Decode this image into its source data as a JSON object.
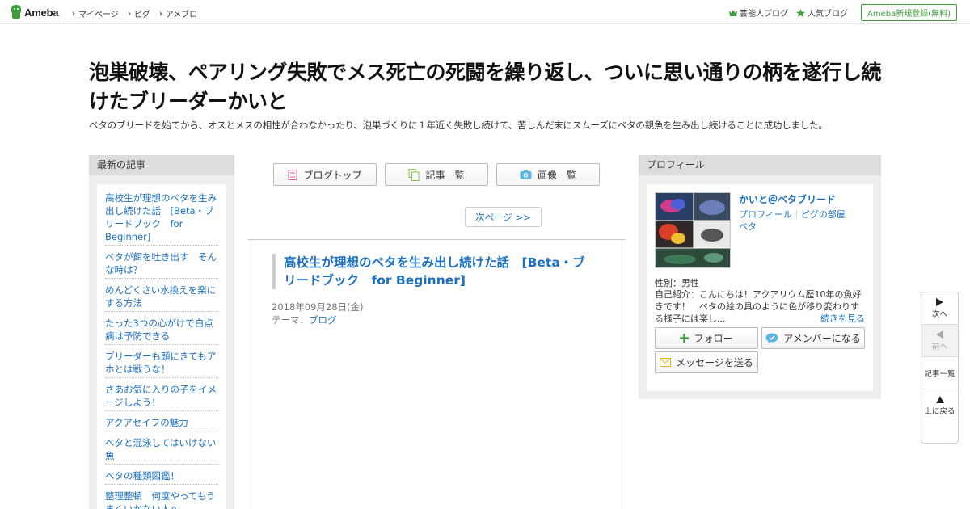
{
  "topbar": {
    "logo_text": "Ameba",
    "nav": [
      "マイページ",
      "ピグ",
      "アメブロ"
    ],
    "right": {
      "celebrity_blog": "芸能人ブログ",
      "popular_blog": "人気ブログ",
      "register": "Ameba新規登録(無料)"
    }
  },
  "header": {
    "title": "泡巣破壊、ペアリング失敗でメス死亡の死闘を繰り返し、ついに思い通りの柄を遂行し続けたブリーダーかいと",
    "description": "ベタのブリードを始てから、オスとメスの相性が合わなかったり、泡巣づくりに１年近く失敗し続けて、苦しんだ末にスムーズにベタの親魚を生み出し続けることに成功しました。"
  },
  "sidebar": {
    "heading": "最新の記事",
    "articles": [
      "高校生が理想のベタを生み出し続けた話　[Beta・ブリードブック　for Beginner]",
      "ベタが餌を吐き出す　そんな時は？",
      "めんどくさい水換えを楽にする方法",
      "たった3つの心がけで白点病は予防できる",
      "ブリーダーも頭にきてもアホとは戦うな！",
      "さあお気に入りの子をイメージしよう！",
      "アクアセイフの魅力",
      "ベタと混泳してはいけない魚",
      "ベタの種類図鑑！",
      "整理整頓　何度やってもうまくいかない人へ"
    ]
  },
  "center": {
    "buttons": {
      "blog_top": "ブログトップ",
      "article_list": "記事一覧",
      "image_list": "画像一覧"
    },
    "next_page": "次ページ >>",
    "entry": {
      "title": "高校生が理想のベタを生み出し続けた話　[Beta・ブリードブック　for Beginner]",
      "date": "2018年09月28日(金)",
      "theme_label": "テーマ：",
      "theme": "ブログ"
    }
  },
  "profile": {
    "heading": "プロフィール",
    "name": "かいと＠ベタブリード",
    "link_profile": "プロフィール",
    "link_room": "ピグの部屋",
    "link_beta": "ベタ",
    "gender": "性別：男性",
    "intro": "自己紹介：こんにちは！アクアリウム歴10年の魚好きです！　ベタの絵の具のように色が移り変わりする様子には楽し...",
    "more": "続きを見る",
    "follow": "フォロー",
    "member": "アメンバーになる",
    "message": "メッセージを送る"
  },
  "floatnav": {
    "next": "次へ",
    "prev": "前へ",
    "list": "記事一覧",
    "top": "上に戻る"
  },
  "colors": {
    "link": "#1a6fc0",
    "brand_green": "#3d9e3d"
  }
}
